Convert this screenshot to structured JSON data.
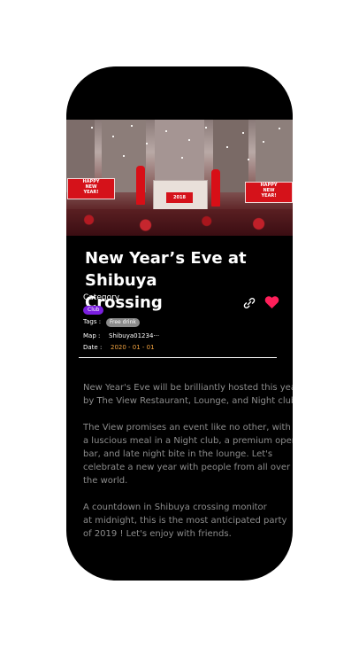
{
  "event": {
    "title": "New Year’s Eve at Shibuya\nCrossing",
    "category_label": "Category",
    "category_chip": "Club",
    "tags_label": "Tags  :",
    "tags": [
      "Free drink"
    ],
    "map_label": "Map    :",
    "map_value": "Shibuya01234···",
    "date_label": "Date    :",
    "date_value": "2020 - 01 - 01",
    "description": [
      "New Year's Eve will be brilliantly hosted this year\nby The View Restaurant, Lounge, and Night club.",
      "The View promises an event like no other, with\na luscious meal in a  Night club, a premium open\nbar, and late night bite in the lounge. Let's\ncelebrate a new year with  people from all over\nthe world.",
      "A countdown in Shibuya crossing monitor\nat midnight, this is the most anticipated party\nof 2019 ! Let's enjoy with friends."
    ]
  },
  "hero_image": {
    "signs": [
      "HAPPY\nNEW\nYEAR!",
      "HAPPY\nNEW\nYEAR!"
    ],
    "stage_text": "2018"
  },
  "icons": {
    "link": "link-icon",
    "favorite": "heart-icon",
    "heart_color": "#ff1f5a"
  },
  "colors": {
    "category_chip": "#7b1fe0",
    "tag_chip": "#8a8a8a",
    "date_value": "#f2a340"
  }
}
